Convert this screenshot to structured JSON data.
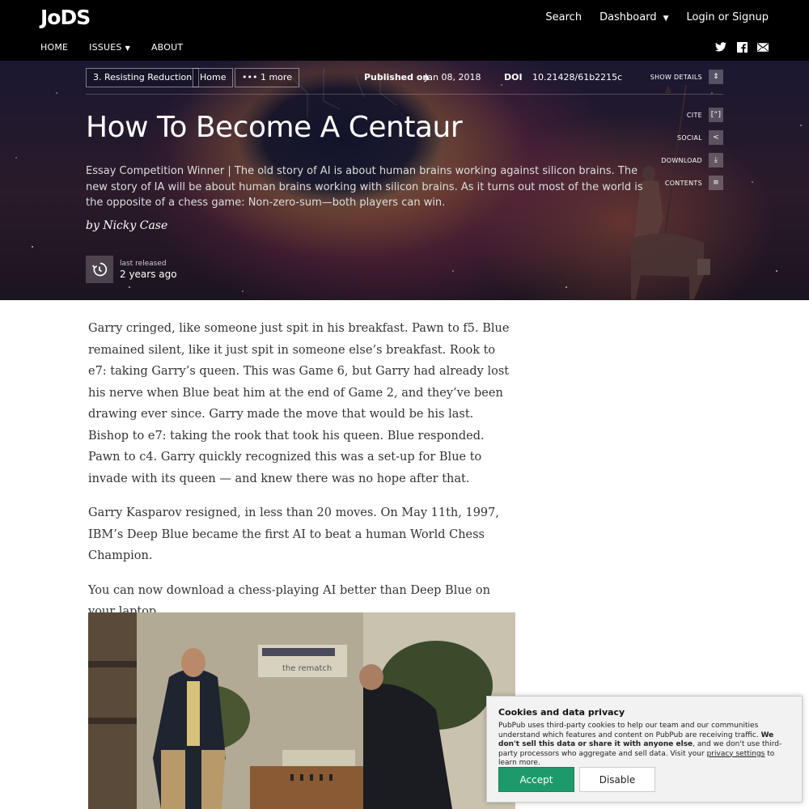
{
  "header": {
    "logo": "JoDS",
    "links": {
      "search": "Search",
      "dashboard": "Dashboard",
      "login": "Login or Signup"
    },
    "nav": {
      "home": "HOME",
      "issues": "ISSUES",
      "about": "ABOUT"
    }
  },
  "hero": {
    "breadcrumbs": [
      "3. Resisting Reduction",
      "Home",
      "1 more"
    ],
    "published_label": "Published on",
    "published_date": "Jan 08, 2018",
    "doi_label": "DOI",
    "doi_value": "10.21428/61b2215c",
    "show_details": "SHOW DETAILS",
    "actions": {
      "cite": "CITE",
      "social": "SOCIAL",
      "download": "DOWNLOAD",
      "contents": "CONTENTS"
    },
    "title": "How To Become A Centaur",
    "subtitle": "Essay Competition Winner | The old story of AI is about human brains working against silicon brains. The new story of IA will be about human brains working with silicon brains. As it turns out most of the world is the opposite of a chess game: Non-zero-sum—both players can win.",
    "byline": "by Nicky Case",
    "release_label": "last released",
    "release_value": "2 years ago"
  },
  "article": {
    "paragraphs": [
      "Garry cringed, like someone just spit in his breakfast.  Pawn to f5.  Blue remained silent, like it just spit in someone else’s breakfast.  Rook to e7: taking Garry’s queen.   This was Game 6, but Garry had already lost his nerve when Blue beat him at the end of Game 2, and they’ve been drawing ever since.  Garry made the move that would be his last.  Bishop to e7: taking the rook that took his queen.  Blue responded.  Pawn to c4.  Garry quickly recognized this was a set-up for Blue to invade with its queen — and knew there was no hope after that.",
      "Garry Kasparov resigned, in less than 20 moves.  On May 11th, 1997, IBM’s Deep Blue became the first AI to beat a human World Chess Champion.",
      "You can now download a chess-playing AI better than Deep Blue on your laptop."
    ]
  },
  "video": {
    "banner_text": "the rematch"
  },
  "cookie": {
    "title": "Cookies and data privacy",
    "text_a": "PubPub uses third-party cookies to help our team and our communities understand which features and content on PubPub are receiving traffic. ",
    "text_bold": "We don't sell this data or share it with anyone else",
    "text_b": ", and we don't use third-party processors who aggregate and sell data. Visit your ",
    "text_link": "privacy settings",
    "text_c": " to learn more.",
    "accept": "Accept",
    "disable": "Disable"
  }
}
